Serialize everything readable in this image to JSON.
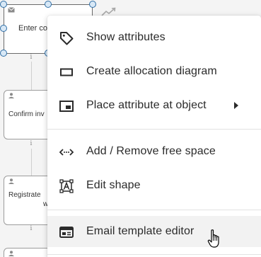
{
  "diagram": {
    "shapes": [
      {
        "label": "Enter con",
        "kind": "email"
      },
      {
        "label": "Confirm inv",
        "kind": "user"
      },
      {
        "label": "Registrate",
        "label2": "w",
        "kind": "user"
      }
    ]
  },
  "context_menu": {
    "items": [
      {
        "label": "Show attributes",
        "icon": "tag-icon"
      },
      {
        "label": "Create allocation diagram",
        "icon": "rectangle-icon"
      },
      {
        "label": "Place attribute at object",
        "icon": "attribute-placement-icon",
        "has_submenu": true
      },
      {
        "label": "Add / Remove free space",
        "icon": "free-space-icon"
      },
      {
        "label": "Edit shape",
        "icon": "edit-shape-icon"
      },
      {
        "label": "Email template editor",
        "icon": "email-template-icon",
        "hovered": true
      }
    ]
  },
  "colors": {
    "menu_background": "#ffffff",
    "hover_background": "#f2f2f2",
    "text": "#2b2b2b",
    "selection_handle": "#2f6ea6"
  }
}
